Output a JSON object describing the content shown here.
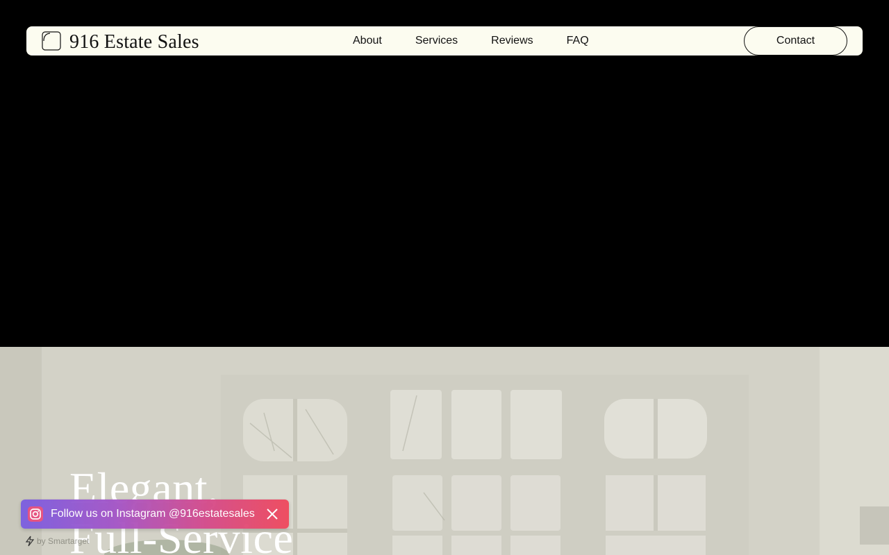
{
  "header": {
    "brand": "916 Estate Sales",
    "logo_icon": "rounded-square-logo-icon",
    "nav": [
      "About",
      "Services",
      "Reviews",
      "FAQ"
    ],
    "contact_label": "Contact"
  },
  "hero": {
    "heading_line1": "Elegant,",
    "heading_line2": "Full-Service"
  },
  "instagram_bar": {
    "icon": "instagram-icon",
    "text": "Follow us on Instagram @916estatesales",
    "close_icon": "close-icon"
  },
  "powered_by": {
    "icon": "lightning-icon",
    "text": "by Smartarget"
  },
  "colors": {
    "navbar_bg": "#fcfcf0",
    "page_bg": "#000000",
    "hero_text": "#ffffff",
    "insta_gradient_start": "#7b5ee0",
    "insta_gradient_end": "#ef4a5d"
  }
}
